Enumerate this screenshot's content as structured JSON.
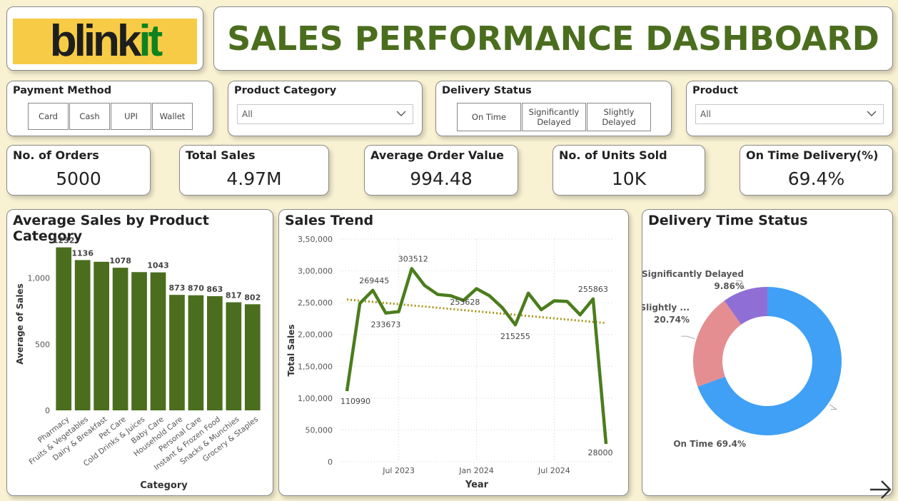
{
  "logo": {
    "part1": "blink",
    "part2": "it"
  },
  "title": "SALES PERFORMANCE DASHBOARD",
  "slicers": {
    "payment": {
      "title": "Payment Method",
      "options": [
        "Card",
        "Cash",
        "UPI",
        "Wallet"
      ]
    },
    "category": {
      "title": "Product Category",
      "value": "All"
    },
    "delivery": {
      "title": "Delivery Status",
      "options": [
        "On Time",
        "Significantly Delayed",
        "Slightly Delayed"
      ]
    },
    "product": {
      "title": "Product",
      "value": "All"
    }
  },
  "kpis": [
    {
      "label": "No. of Orders",
      "value": "5000"
    },
    {
      "label": "Total Sales",
      "value": "4.97M"
    },
    {
      "label": "Average Order Value",
      "value": "994.48"
    },
    {
      "label": "No. of Units Sold",
      "value": "10K"
    },
    {
      "label": "On Time Delivery(%)",
      "value": "69.4%"
    }
  ],
  "colors": {
    "bar": "#4b6e1e",
    "line": "#4b7d1c",
    "trend": "#a89418",
    "title": "#4b6e1e",
    "on_time": "#3fa0f5",
    "slightly": "#e48e92",
    "significantly": "#8f6fd6"
  },
  "chart_data": [
    {
      "type": "bar",
      "title": "Average Sales by Product Category",
      "xlabel": "Category",
      "ylabel": "Average of Sales",
      "ylim": [
        0,
        1300
      ],
      "yticks": [
        0,
        500,
        1000
      ],
      "ytick_labels": [
        "0",
        "500",
        "1,000"
      ],
      "categories": [
        "Pharmacy",
        "Fruits & Vegetables",
        "Dairy & Breakfast",
        "Pet Care",
        "Cold Drinks & Juices",
        "Baby Care",
        "Household Care",
        "Personal Care",
        "Instant & Frozen Food",
        "Snacks & Munchies",
        "Grocery & Staples"
      ],
      "values": [
        1232,
        1136,
        1123,
        1078,
        1045,
        1043,
        873,
        870,
        863,
        817,
        802
      ],
      "data_labels": [
        "1232",
        "1136",
        "",
        "1078",
        "",
        "1043",
        "873",
        "870",
        "863",
        "817",
        "802"
      ]
    },
    {
      "type": "line",
      "title": "Sales Trend",
      "xlabel": "Year",
      "ylabel": "Total Sales",
      "ylim": [
        0,
        350000
      ],
      "yticks": [
        0,
        50000,
        100000,
        150000,
        200000,
        250000,
        300000,
        350000
      ],
      "ytick_labels": [
        "0",
        "50,000",
        "1,00,000",
        "1,50,000",
        "2,00,000",
        "2,50,000",
        "3,00,000",
        "3,50,000"
      ],
      "xticks": [
        "2023-07",
        "2024-01",
        "2024-07"
      ],
      "xtick_labels": [
        "Jul 2023",
        "Jan 2024",
        "Jul 2024"
      ],
      "x": [
        "2023-03",
        "2023-04",
        "2023-05",
        "2023-06",
        "2023-07",
        "2023-08",
        "2023-09",
        "2023-10",
        "2023-11",
        "2023-12",
        "2024-01",
        "2024-02",
        "2024-03",
        "2024-04",
        "2024-05",
        "2024-06",
        "2024-07",
        "2024-08",
        "2024-09",
        "2024-10",
        "2024-11"
      ],
      "values": [
        110990,
        249000,
        269445,
        233673,
        236000,
        303512,
        277000,
        263000,
        261000,
        253628,
        272000,
        261000,
        242000,
        215255,
        265000,
        239000,
        253000,
        252000,
        231000,
        255863,
        28000
      ],
      "data_labels": [
        "110990",
        "",
        "269445",
        "233673",
        "",
        "303512",
        "",
        "",
        "",
        "253628",
        "",
        "",
        "",
        "215255",
        "",
        "",
        "",
        "",
        "",
        "255863",
        "28000"
      ],
      "trendline": {
        "start": 255000,
        "end": 218000
      }
    },
    {
      "type": "pie",
      "title": "Delivery Time Status",
      "categories": [
        "On Time",
        "Slightly ...",
        "Significantly Delayed"
      ],
      "values": [
        69.4,
        20.74,
        9.86
      ],
      "data_labels": [
        "69.4%",
        "20.74%",
        "9.86%"
      ]
    }
  ]
}
